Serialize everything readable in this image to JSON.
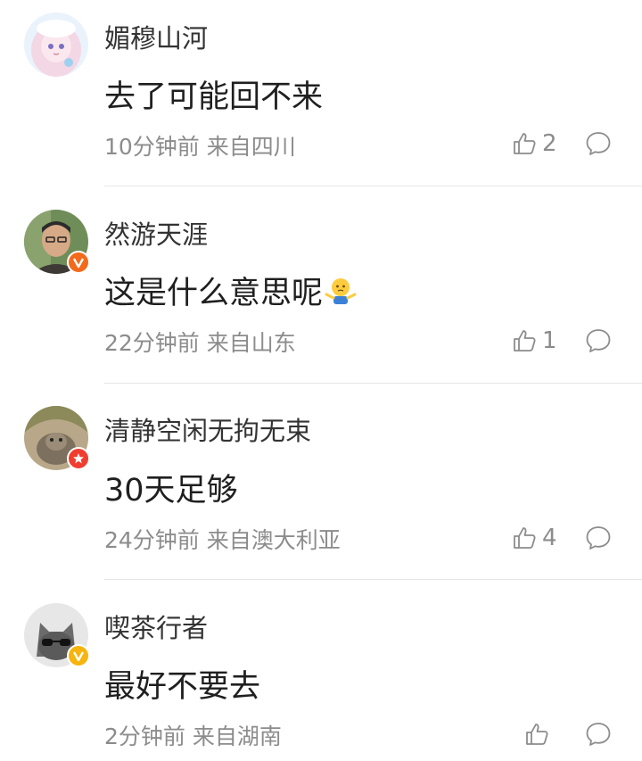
{
  "comments": [
    {
      "user": "媚穆山河",
      "text": "去了可能回不来",
      "meta": "10分钟前 来自四川",
      "likes": "2",
      "badge": null,
      "avatar_colors": [
        "#eaf2fb",
        "#f7d9e6"
      ]
    },
    {
      "user": "然游天涯",
      "text": "这是什么意思呢",
      "emoji": "shrug-emoji",
      "meta": "22分钟前 来自山东",
      "likes": "1",
      "badge": "#f26a1b",
      "avatar_colors": [
        "#6f8d59",
        "#3d3a36"
      ]
    },
    {
      "user": "清静空闲无拘无束",
      "text": "30天足够",
      "meta": "24分钟前 来自澳大利亚",
      "likes": "4",
      "badge": "#ef3d2f",
      "avatar_colors": [
        "#b8a889",
        "#6e6454"
      ]
    },
    {
      "user": "喫茶行者",
      "text": "最好不要去",
      "meta": "2分钟前 来自湖南",
      "likes": "",
      "badge": "#f6b40e",
      "avatar_colors": [
        "#e7e7e7",
        "#5a5a5a"
      ]
    }
  ],
  "icons": {
    "like": "thumbs-up-icon",
    "reply": "comment-bubble-icon"
  },
  "colors": {
    "meta": "#8c8c8c",
    "divider": "#e6e6e6"
  }
}
